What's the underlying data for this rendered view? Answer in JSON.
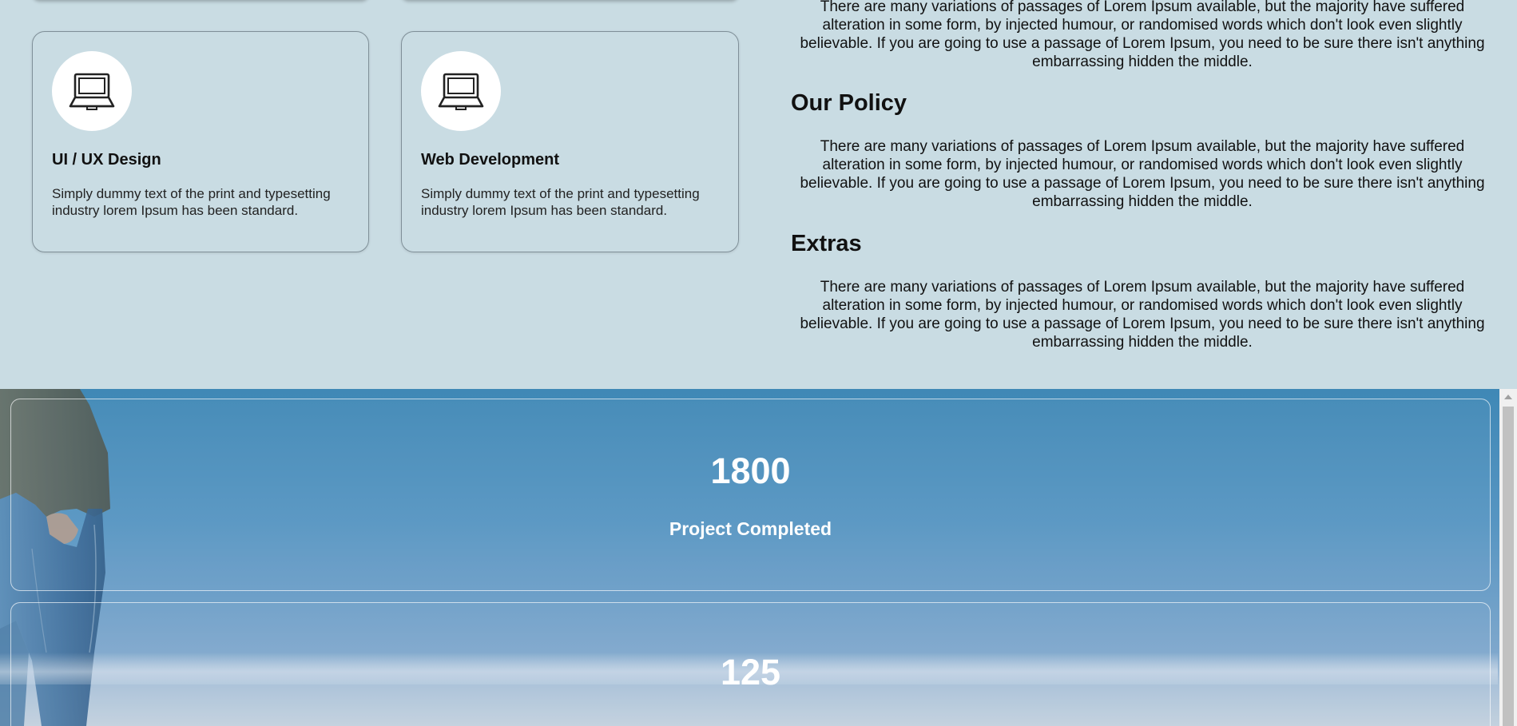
{
  "services": {
    "cards": [
      {
        "icon": "laptop-icon",
        "title": "UI / UX Design",
        "text": "Simply dummy text of the print and typesetting industry lorem Ipsum has been standard."
      },
      {
        "icon": "laptop-icon",
        "title": "Web Development",
        "text": "Simply dummy text of the print and typesetting industry lorem Ipsum has been standard."
      }
    ]
  },
  "about": {
    "intro_text": "There are many variations of passages of Lorem Ipsum available, but the majority have suffered alteration in some form, by injected humour, or randomised words which don't look even slightly believable. If you are going to use a passage of Lorem Ipsum, you need to be sure there isn't anything embarrassing hidden the middle.",
    "sections": [
      {
        "heading": "Our Policy",
        "text": "There are many variations of passages of Lorem Ipsum available, but the majority have suffered alteration in some form, by injected humour, or randomised words which don't look even slightly believable. If you are going to use a passage of Lorem Ipsum, you need to be sure there isn't anything embarrassing hidden the middle."
      },
      {
        "heading": "Extras",
        "text": "There are many variations of passages of Lorem Ipsum available, but the majority have suffered alteration in some form, by injected humour, or randomised words which don't look even slightly believable. If you are going to use a passage of Lorem Ipsum, you need to be sure there isn't anything embarrassing hidden the middle."
      }
    ]
  },
  "stats": [
    {
      "number": "1800",
      "label": "Project Completed"
    },
    {
      "number": "125",
      "label": ""
    }
  ],
  "colors": {
    "page_background": "#c9dce3",
    "stats_background": "#4a8dbb",
    "stat_text": "#ffffff"
  }
}
